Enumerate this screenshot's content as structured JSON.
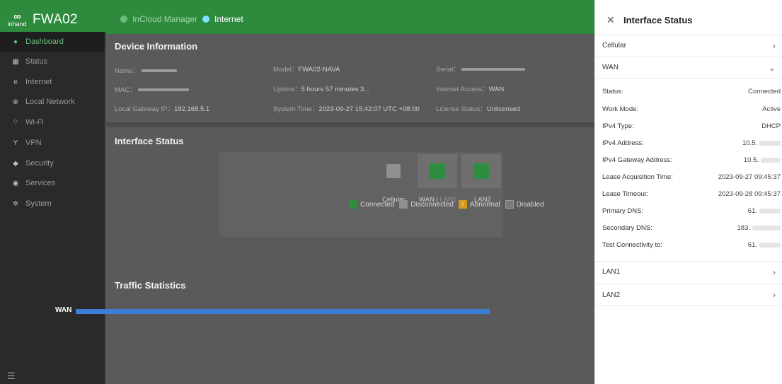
{
  "app": {
    "brand_mark": "inhand",
    "name": "FWA02"
  },
  "header": {
    "nav": [
      {
        "label": "InCloud Manager",
        "dot_color": "#6cbf79"
      },
      {
        "label": "Internet",
        "dot_color": "#7fe0ff"
      }
    ]
  },
  "sidebar": {
    "items": [
      {
        "label": "Dashboard",
        "icon": "dashboard-icon",
        "active": true
      },
      {
        "label": "Status",
        "icon": "status-icon"
      },
      {
        "label": "Internet",
        "icon": "internet-icon"
      },
      {
        "label": "Local Network",
        "icon": "local-network-icon"
      },
      {
        "label": "Wi-Fi",
        "icon": "wifi-icon"
      },
      {
        "label": "VPN",
        "icon": "vpn-icon"
      },
      {
        "label": "Security",
        "icon": "shield-icon"
      },
      {
        "label": "Services",
        "icon": "services-icon"
      },
      {
        "label": "System",
        "icon": "gear-icon"
      }
    ],
    "collapse_icon": "collapse-menu-icon"
  },
  "device_info": {
    "title": "Device Information",
    "name_label": "Name",
    "model_label": "Model",
    "model_value": "FWA02-NAVA",
    "serial_label": "Serial",
    "mac_label": "MAC",
    "uptime_label": "Uptime",
    "uptime_value": "5 hours 57 minutes 3...",
    "internet_access_label": "Internet Access",
    "internet_access_value": "WAN",
    "gateway_label": "Local Gateway IP",
    "gateway_value": "192.168.5.1",
    "system_time_label": "System Time",
    "system_time_value": "2023-09-27 15:42:07 UTC +08:00",
    "license_label": "License Status",
    "license_value": "Unlicensed"
  },
  "interface_status": {
    "title": "Interface Status",
    "ports": {
      "cellular": "Cellular",
      "wan": "WAN",
      "wan_sep": "|",
      "lan1": "LAN1",
      "lan2": "LAN2"
    },
    "legend": {
      "connected": "Connected",
      "disconnected": "Disconnected",
      "abnormal": "Abnormal",
      "disabled": "Disabled"
    },
    "colors": {
      "connected": "#2f8d3f",
      "disconnected": "#9a9a9a",
      "abnormal": "#e0a020",
      "disabled": "#b5b5b5"
    }
  },
  "traffic": {
    "title": "Traffic Statistics",
    "series_label": "WAN",
    "bar_color": "#3b7fd4"
  },
  "drawer": {
    "title": "Interface Status",
    "sections": {
      "cellular": "Cellular",
      "wan": "WAN",
      "lan1": "LAN1",
      "lan2": "LAN2"
    },
    "wan_rows": [
      {
        "label": "Status:",
        "value": "Connected"
      },
      {
        "label": "Work Mode:",
        "value": "Active"
      },
      {
        "label": "IPv4 Type:",
        "value": "DHCP"
      },
      {
        "label": "IPv4 Address:",
        "value": "10.5."
      },
      {
        "label": "IPv4 Gateway Address:",
        "value": "10.5."
      },
      {
        "label": "Lease Acquisition Time:",
        "value": "2023-09-27 09:45:37"
      },
      {
        "label": "Lease Timeout:",
        "value": "2023-09-28 09:45:37"
      },
      {
        "label": "Primary DNS:",
        "value": "61."
      },
      {
        "label": "Secondary DNS:",
        "value": "183."
      },
      {
        "label": "Test Connectivity to:",
        "value": "61."
      }
    ]
  }
}
